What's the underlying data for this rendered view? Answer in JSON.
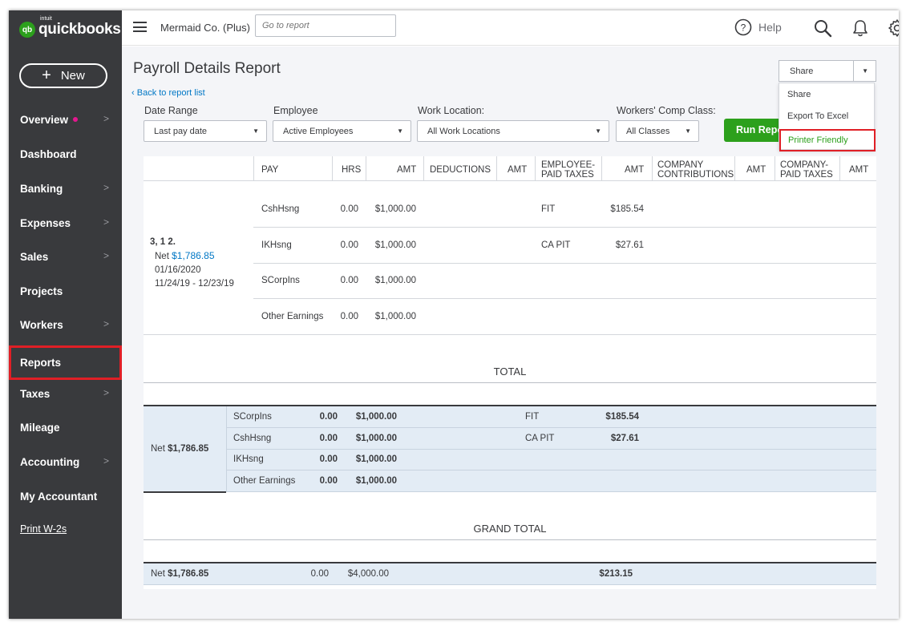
{
  "app": {
    "logo_intuit": "intuit",
    "logo_text": "quickbooks",
    "logo_badge": "qb"
  },
  "sidebar": {
    "new_label": "New",
    "items": [
      {
        "label": "Overview",
        "has_dot": true,
        "chevron": true
      },
      {
        "label": "Dashboard",
        "chevron": false
      },
      {
        "label": "Banking",
        "chevron": true
      },
      {
        "label": "Expenses",
        "chevron": true
      },
      {
        "label": "Sales",
        "chevron": true
      },
      {
        "label": "Projects",
        "chevron": false
      },
      {
        "label": "Workers",
        "chevron": true
      },
      {
        "label": "Reports",
        "chevron": false,
        "selected": true
      },
      {
        "label": "Taxes",
        "chevron": true
      },
      {
        "label": "Mileage",
        "chevron": false
      },
      {
        "label": "Accounting",
        "chevron": true
      },
      {
        "label": "My Accountant",
        "chevron": false
      },
      {
        "label": "Print W-2s",
        "chevron": false
      }
    ]
  },
  "header": {
    "company": "Mermaid Co. (Plus)",
    "goto_placeholder": "Go to report",
    "help_label": "Help",
    "icons": [
      "hamburger-icon",
      "help-icon",
      "search-icon",
      "bell-icon",
      "gear-icon"
    ]
  },
  "page": {
    "title": "Payroll Details Report",
    "back_link": "Back to report list",
    "filters": {
      "date_range_label": "Date Range",
      "date_range_value": "Last pay date",
      "employee_label": "Employee",
      "employee_value": "Active Employees",
      "work_location_label": "Work Location:",
      "work_location_value": "All Work Locations",
      "wc_label": "Workers' Comp Class:",
      "wc_value": "All Classes"
    },
    "run_report": "Run Report",
    "share": {
      "button": "Share",
      "menu": [
        "Share",
        "Export To Excel",
        "Printer Friendly"
      ],
      "highlighted": "Printer Friendly"
    }
  },
  "report": {
    "columns": {
      "pay": "PAY",
      "hrs": "HRS",
      "amt": "AMT",
      "deductions": "DEDUCTIONS",
      "amt2": "AMT",
      "emp_taxes_1": "EMPLOYEE-",
      "emp_taxes_2": "PAID TAXES",
      "amt3": "AMT",
      "company_contrib_1": "COMPANY",
      "company_contrib_2": "CONTRIBUTIONS",
      "amt4": "AMT",
      "company_taxes_1": "COMPANY-",
      "company_taxes_2": "PAID TAXES",
      "amt5": "AMT"
    },
    "employee": {
      "name": "3, 1 2.",
      "net_label": "Net",
      "net_value": "$1,786.85",
      "pay_date": "01/16/2020",
      "period": "11/24/19 -  12/23/19"
    },
    "rows": [
      {
        "pay": "CshHsng",
        "hrs": "0.00",
        "amt": "$1,000.00",
        "tax": "FIT",
        "tax_amt": "$185.54"
      },
      {
        "pay": "IKHsng",
        "hrs": "0.00",
        "amt": "$1,000.00",
        "tax": "CA PIT",
        "tax_amt": "$27.61"
      },
      {
        "pay": "SCorpIns",
        "hrs": "0.00",
        "amt": "$1,000.00",
        "tax": "",
        "tax_amt": ""
      },
      {
        "pay": "Other Earnings",
        "hrs": "0.00",
        "amt": "$1,000.00",
        "tax": "",
        "tax_amt": ""
      }
    ],
    "total": {
      "heading": "TOTAL",
      "net_label": "Net",
      "net_value": "$1,786.85",
      "rows": [
        {
          "pay": "SCorpIns",
          "hrs": "0.00",
          "amt": "$1,000.00",
          "tax": "FIT",
          "tax_amt": "$185.54"
        },
        {
          "pay": "CshHsng",
          "hrs": "0.00",
          "amt": "$1,000.00",
          "tax": "CA PIT",
          "tax_amt": "$27.61"
        },
        {
          "pay": "IKHsng",
          "hrs": "0.00",
          "amt": "$1,000.00",
          "tax": "",
          "tax_amt": ""
        },
        {
          "pay": "Other Earnings",
          "hrs": "0.00",
          "amt": "$1,000.00",
          "tax": "",
          "tax_amt": ""
        }
      ]
    },
    "grand_total": {
      "heading": "GRAND TOTAL",
      "net_label": "Net",
      "net_value": "$1,786.85",
      "hrs": "0.00",
      "amt": "$4,000.00",
      "tax_amt": "$213.15"
    }
  }
}
